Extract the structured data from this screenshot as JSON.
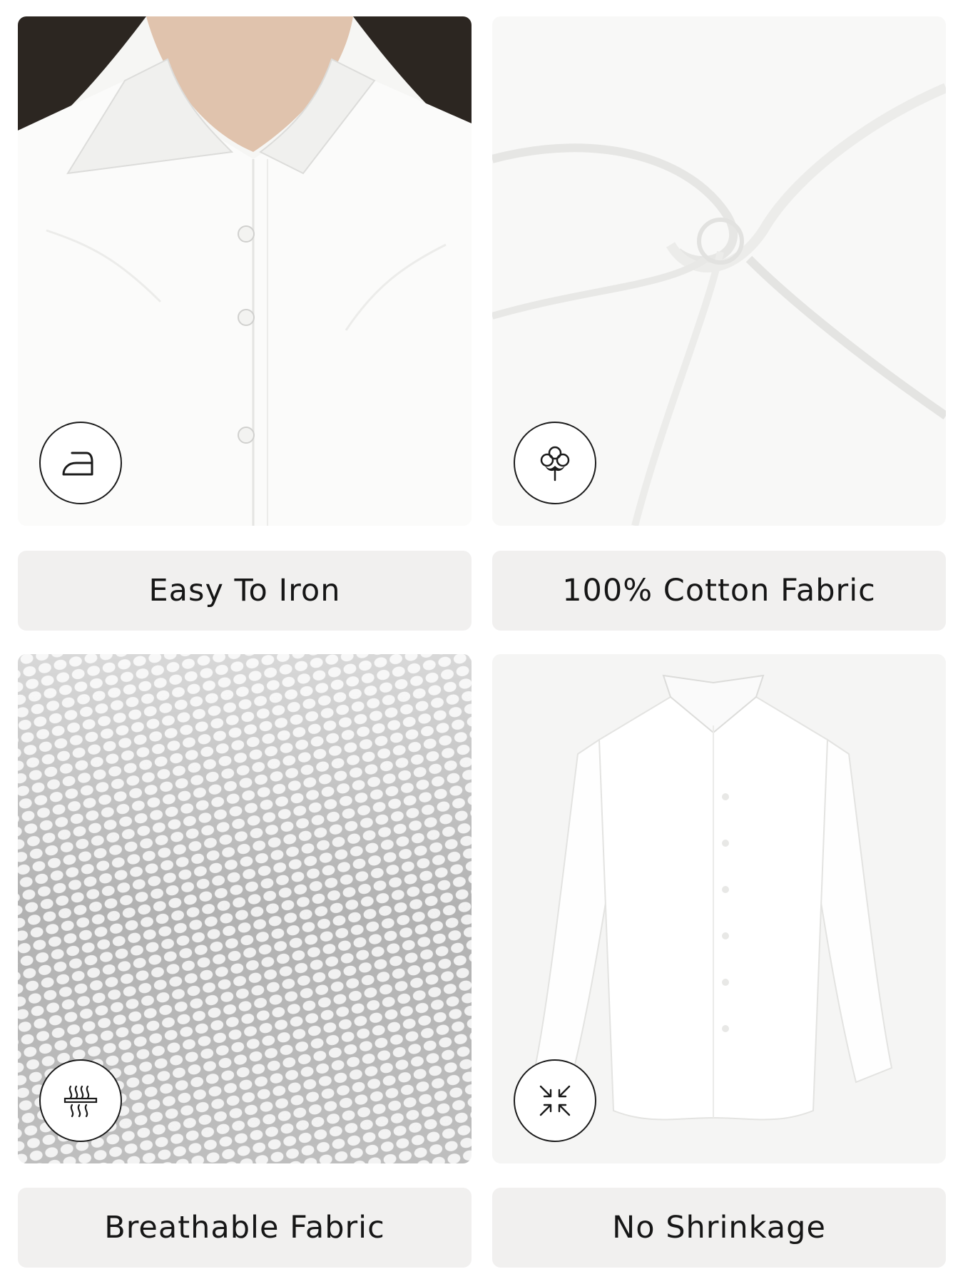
{
  "features": [
    {
      "label": "Easy To Iron",
      "icon": "iron-icon",
      "image": "model-wearing-shirt-collar"
    },
    {
      "label": "100% Cotton Fabric",
      "icon": "cotton-flower-icon",
      "image": "swirled-white-fabric"
    },
    {
      "label": "Breathable Fabric",
      "icon": "breathable-airflow-icon",
      "image": "fabric-weave-closeup"
    },
    {
      "label": "No Shrinkage",
      "icon": "no-shrink-arrows-icon",
      "image": "flat-lay-white-shirt"
    }
  ],
  "colors": {
    "label_background": "#f1f0ef",
    "text": "#161616",
    "icon_stroke": "#1a1a1a"
  }
}
